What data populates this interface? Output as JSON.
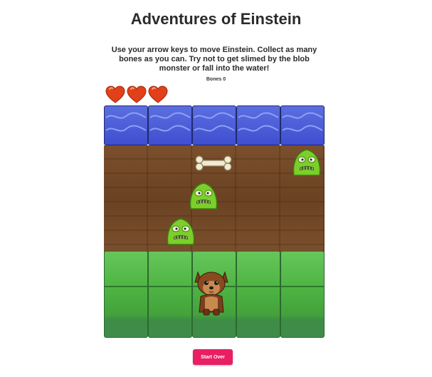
{
  "game": {
    "title": "Adventures of Einstein",
    "instructions": "Use your arrow keys to move Einstein. Collect as many bones as you can. Try not to get slimed by the blob monster or fall into the water!",
    "score_label": "Bones 0",
    "bones": 0,
    "lives": 3,
    "start_over_label": "Start Over"
  },
  "board": {
    "columns": 5,
    "rows": [
      "water",
      "dirt",
      "dirt",
      "dirt",
      "grass",
      "grass"
    ],
    "sprites": [
      {
        "name": "bone",
        "column": 3,
        "row": 2
      },
      {
        "name": "slime-monster",
        "column": 5,
        "row": 2
      },
      {
        "name": "slime-monster",
        "column": 3,
        "row": 3
      },
      {
        "name": "slime-monster",
        "column": 2,
        "row": 4
      },
      {
        "name": "dog-einstein",
        "column": 3,
        "row": 5
      }
    ]
  },
  "colors": {
    "water": "#4a5ad8",
    "dirt": "#6f4525",
    "grass": "#4fb544",
    "slime": "#7ccf2a",
    "heart": "#e2401a",
    "button": "#e91e63"
  }
}
